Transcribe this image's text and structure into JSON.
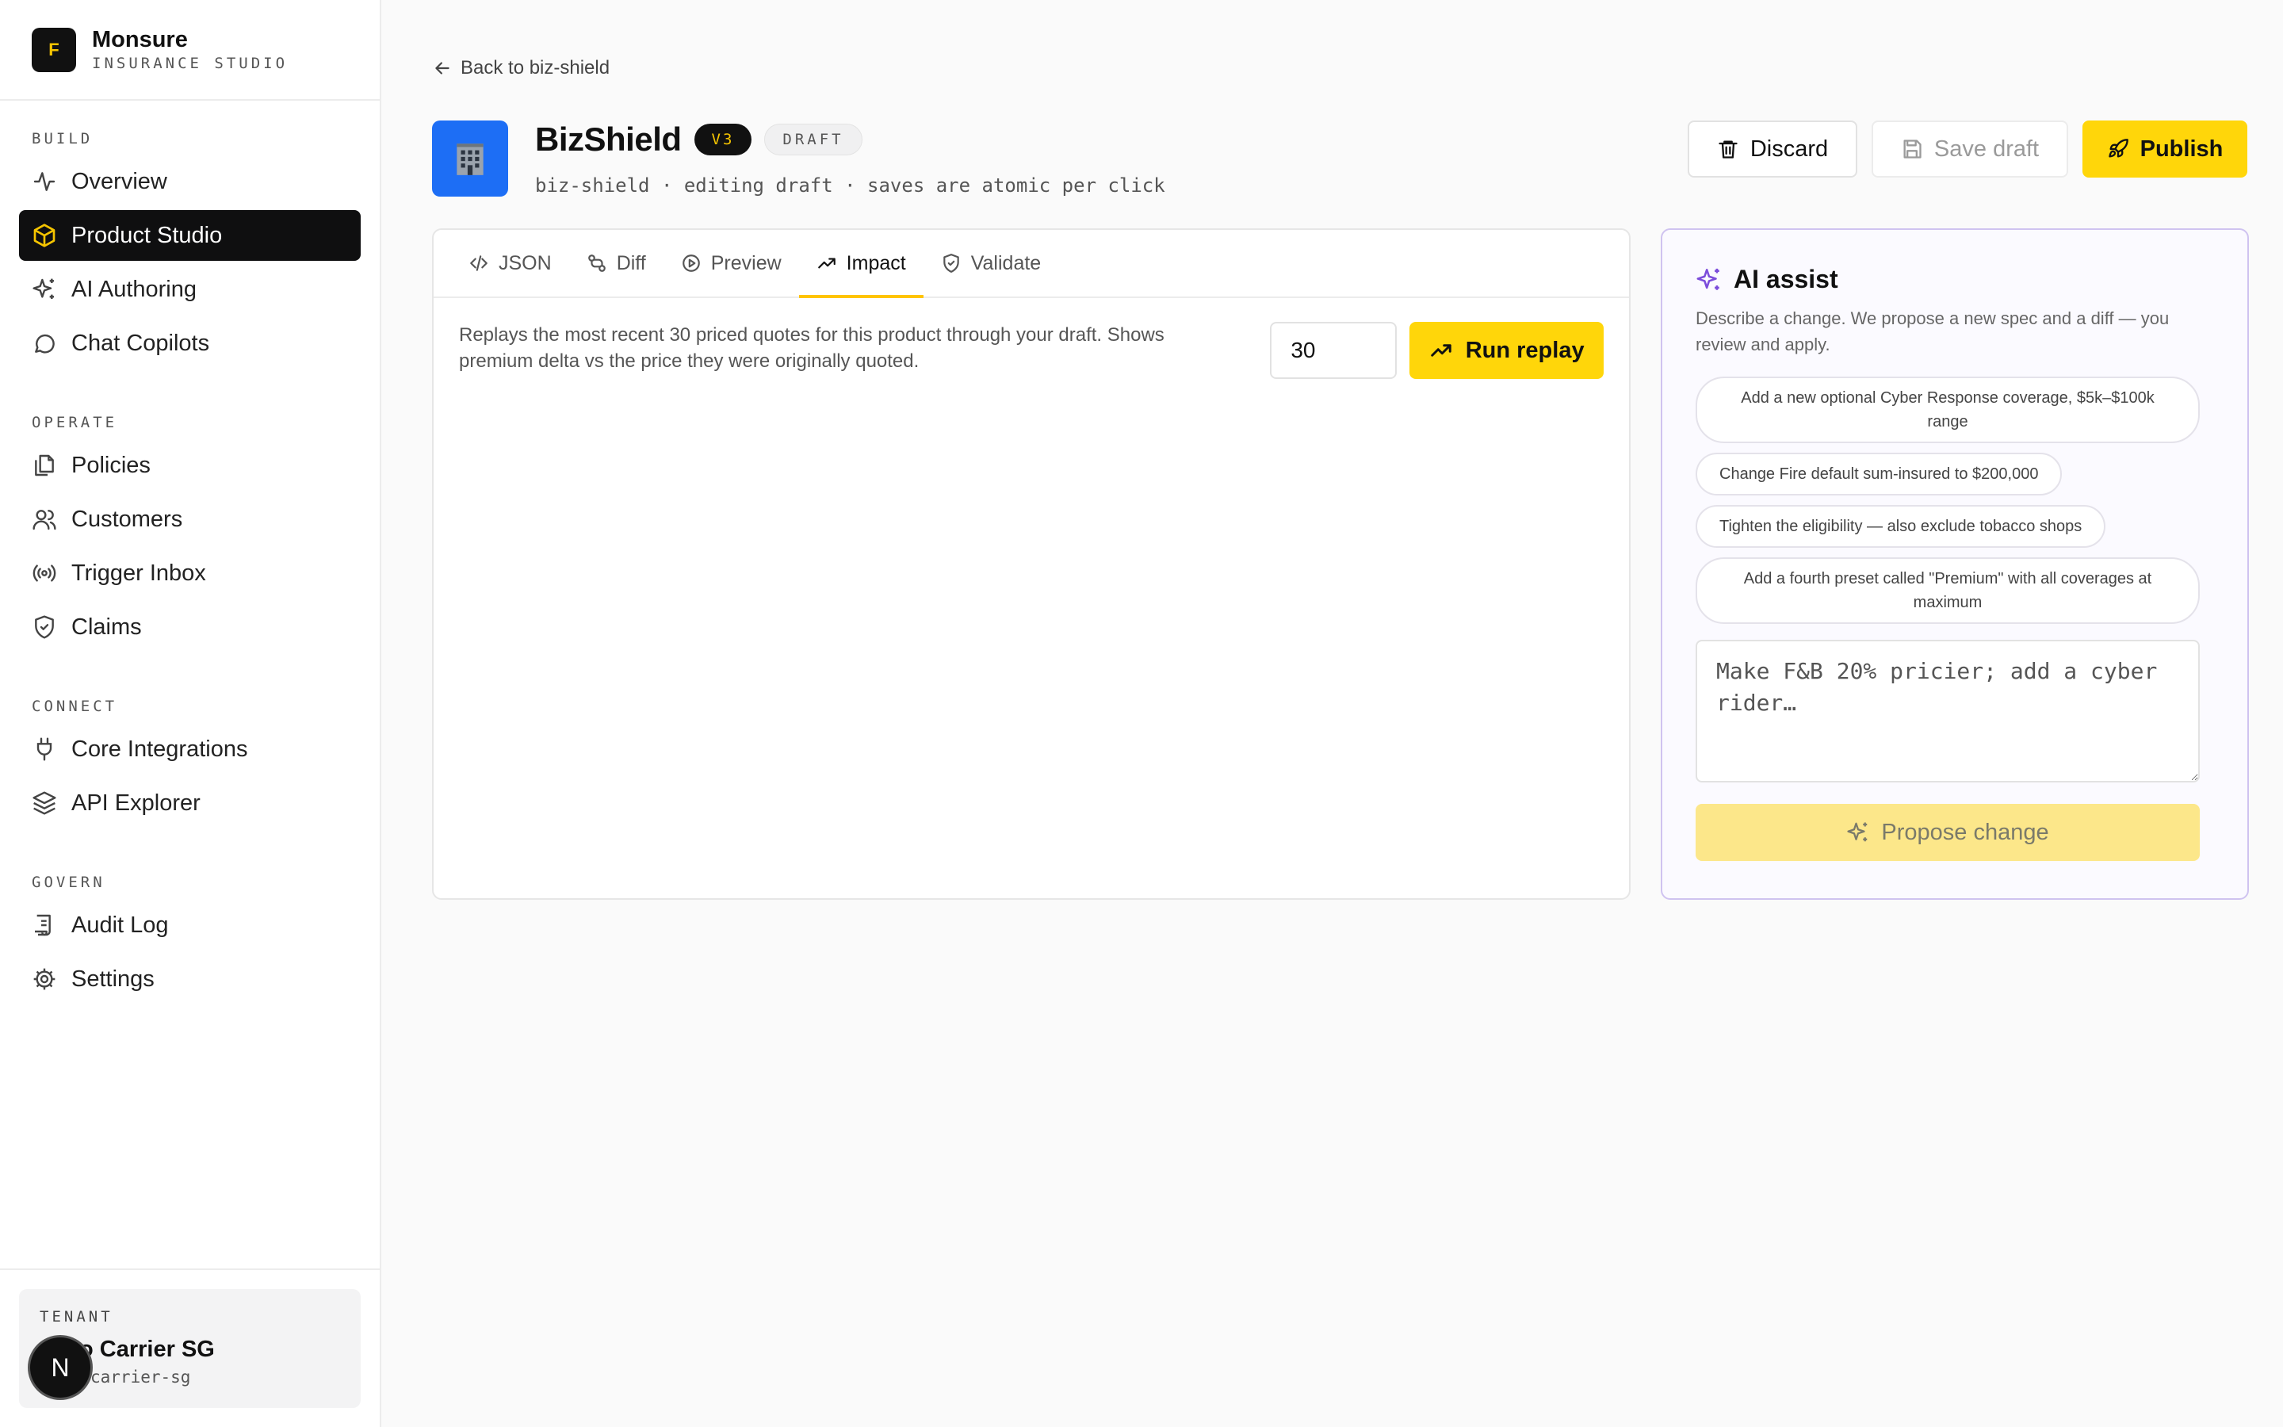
{
  "brand": {
    "logo_letter": "F",
    "name": "Monsure",
    "subtitle": "INSURANCE STUDIO"
  },
  "sidebar": {
    "sections": [
      {
        "heading": "BUILD",
        "items": [
          {
            "label": "Overview",
            "icon": "activity-icon"
          },
          {
            "label": "Product Studio",
            "icon": "cube-icon",
            "active": true
          },
          {
            "label": "AI Authoring",
            "icon": "sparkles-icon"
          },
          {
            "label": "Chat Copilots",
            "icon": "chat-bubble-icon"
          }
        ]
      },
      {
        "heading": "OPERATE",
        "items": [
          {
            "label": "Policies",
            "icon": "files-icon"
          },
          {
            "label": "Customers",
            "icon": "users-icon"
          },
          {
            "label": "Trigger Inbox",
            "icon": "radio-signal-icon"
          },
          {
            "label": "Claims",
            "icon": "shield-check-icon"
          }
        ]
      },
      {
        "heading": "CONNECT",
        "items": [
          {
            "label": "Core Integrations",
            "icon": "plug-icon"
          },
          {
            "label": "API Explorer",
            "icon": "layers-icon"
          }
        ]
      },
      {
        "heading": "GOVERN",
        "items": [
          {
            "label": "Audit Log",
            "icon": "scroll-icon"
          },
          {
            "label": "Settings",
            "icon": "gear-icon"
          }
        ]
      }
    ]
  },
  "tenant": {
    "label": "TENANT",
    "name": "o Carrier SG",
    "slug": "carrier-sg",
    "avatar_letter": "N"
  },
  "header": {
    "back_label": "Back to biz-shield",
    "product_name": "BizShield",
    "version_badge": "V3",
    "status_badge": "DRAFT",
    "meta": "biz-shield · editing draft · saves are atomic per click",
    "actions": {
      "discard": "Discard",
      "save_draft": "Save draft",
      "publish": "Publish"
    }
  },
  "editor": {
    "tabs": [
      {
        "label": "JSON",
        "icon": "code-icon"
      },
      {
        "label": "Diff",
        "icon": "git-compare-icon"
      },
      {
        "label": "Preview",
        "icon": "play-circle-icon"
      },
      {
        "label": "Impact",
        "icon": "trending-up-icon",
        "active": true
      },
      {
        "label": "Validate",
        "icon": "shield-check-icon"
      }
    ],
    "impact": {
      "description": "Replays the most recent 30 priced quotes for this product through your draft. Shows premium delta vs the price they were originally quoted.",
      "count_value": "30",
      "run_label": "Run replay"
    }
  },
  "ai_assist": {
    "title": "AI assist",
    "description": "Describe a change. We propose a new spec and a diff — you review and apply.",
    "suggestions": [
      "Add a new optional Cyber Response coverage, $5k–$100k range",
      "Change Fire default sum-insured to $200,000",
      "Tighten the eligibility — also exclude tobacco shops",
      "Add a fourth preset called \"Premium\" with all coverages at maximum"
    ],
    "placeholder": "Make F&B 20% pricier; add a cyber rider…",
    "propose_label": "Propose change"
  },
  "colors": {
    "accent": "#ffd60a",
    "ai_border": "#cfc3f0",
    "ai_icon": "#7c4ddb",
    "product_logo": "#1d6ef5"
  }
}
